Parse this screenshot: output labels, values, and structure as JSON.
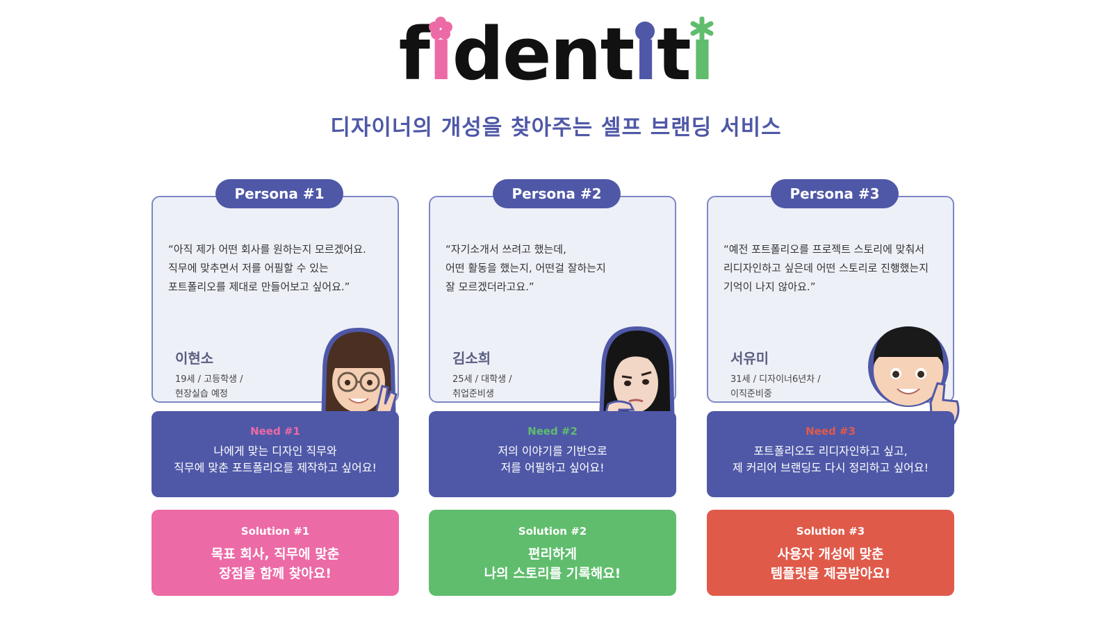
{
  "logo": {
    "part1": "f",
    "i1": "ı",
    "part2": "dent",
    "i2": "ı",
    "part3": "t",
    "i3": "ı"
  },
  "tagline": "디자이너의 개성을 찾아주는 셀프 브랜딩 서비스",
  "colors": {
    "primary": "#4f58a7",
    "pink": "#ec6aa6",
    "green": "#5fbd6d",
    "red": "#e05a4a"
  },
  "personas": [
    {
      "tag": "Persona #1",
      "quote": "“아직 제가 어떤 회사를 원하는지 모르겠어요.\n직무에 맞추면서 저를 어필할 수 있는\n포트폴리오를 제대로 만들어보고 싶어요.”",
      "name": "이현소",
      "info": "19세 / 고등학생 /\n현장실습 예정",
      "avatar": "girl-with-glasses-avatar",
      "need_title": "Need #1",
      "need_text": "나에게 맞는 디자인 직무와\n직무에 맞춘 포트폴리오를 제작하고 싶어요!",
      "solution_title": "Solution #1",
      "solution_text": "목표 회사, 직무에 맞춘\n장점을 함께 찾아요!"
    },
    {
      "tag": "Persona #2",
      "quote": "“자기소개서 쓰려고 했는데,\n어떤 활동을 했는지, 어떤걸 잘하는지\n잘 모르겠더라고요.”",
      "name": "김소희",
      "info": "25세 / 대학생 /\n취업준비생",
      "avatar": "thinking-woman-avatar",
      "need_title": "Need #2",
      "need_text": "저의 이야기를 기반으로\n저를 어필하고 싶어요!",
      "solution_title": "Solution #2",
      "solution_text": "편리하게\n나의 스토리를 기록해요!"
    },
    {
      "tag": "Persona #3",
      "quote": "“예전 포트폴리오를 프로젝트 스토리에 맞춰서\n리디자인하고 싶은데 어떤 스토리로 진행했는지\n기억이 나지 않아요.”",
      "name": "서유미",
      "info": "31세 / 디자이너6년차 /\n이직준비중",
      "avatar": "thumbs-up-boy-avatar",
      "need_title": "Need #3",
      "need_text": "포트폴리오도 리디자인하고 싶고,\n제 커리어 브랜딩도 다시 정리하고 싶어요!",
      "solution_title": "Solution #3",
      "solution_text": "사용자 개성에 맞춘\n템플릿을 제공받아요!"
    }
  ]
}
